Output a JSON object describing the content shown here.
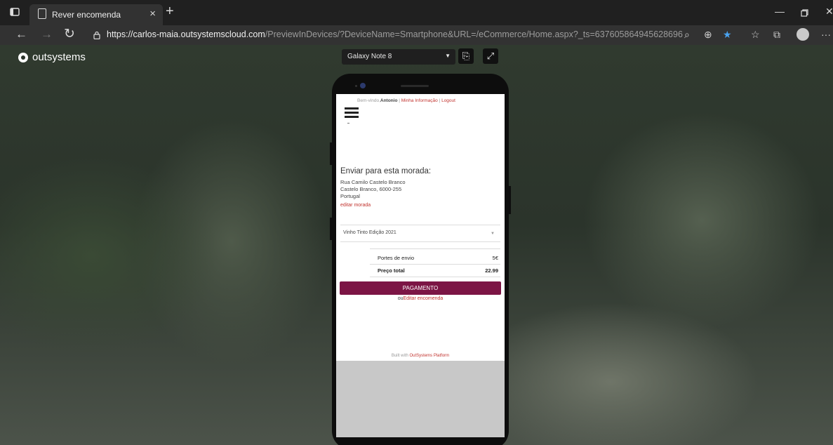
{
  "browser": {
    "tab_title": "Rever encomenda",
    "url_host": "https://carlos-maia.outsystemscloud.com",
    "url_path": "/PreviewInDevices/?DeviceName=Smartphone&URL=/eCommerce/Home.aspx?_ts=637605864945628696",
    "icons": [
      "tab-actions-icon",
      "document-icon",
      "close-icon",
      "plus-icon",
      "minimize-icon",
      "restore-icon",
      "back-icon",
      "forward-icon",
      "reload-icon",
      "lock-icon",
      "read-aloud-icon",
      "zoom-icon",
      "favorite-star-icon",
      "favorites-bar-icon",
      "collections-icon",
      "profile-avatar-icon",
      "more-icon"
    ]
  },
  "preview": {
    "logo_text": "outsystems",
    "device_name": "Galaxy Note 8"
  },
  "app": {
    "welcome_prefix": "Bem-vindo,",
    "user_name": "Antonio",
    "separator1": " | ",
    "my_info": "Minha Informação",
    "separator2": " | ",
    "logout": "Logout",
    "ship_title": "Enviar para esta morada:",
    "address_line1": "Rua Camilo Castelo Branco",
    "address_line2": "Castelo Branco, 6000-255",
    "address_line3": "Portugal",
    "edit_address": "editar morada",
    "product": "Vinho Tinto Edição  2021",
    "shipping_label": "Portes de envio",
    "shipping_value": "5€",
    "total_label": "Preço total",
    "total_value": "22.99",
    "pay_button": "PAGAMENTO",
    "or_text": "ou",
    "edit_order": "Editar encomenda",
    "built_with": "Built with ",
    "platform": "OutSystems Platform"
  }
}
